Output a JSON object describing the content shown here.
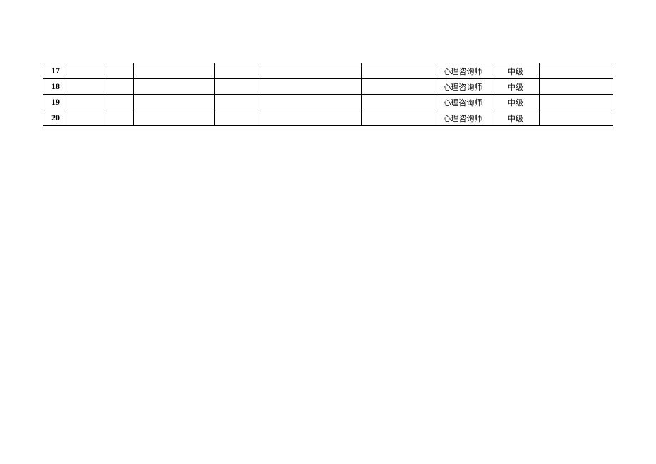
{
  "rows": [
    {
      "num": "17",
      "c2": "",
      "c3": "",
      "c4": "",
      "c5": "",
      "c6": "",
      "c7": "",
      "c8": "心理咨询师",
      "c9": "中级",
      "c10": ""
    },
    {
      "num": "18",
      "c2": "",
      "c3": "",
      "c4": "",
      "c5": "",
      "c6": "",
      "c7": "",
      "c8": "心理咨询师",
      "c9": "中级",
      "c10": ""
    },
    {
      "num": "19",
      "c2": "",
      "c3": "",
      "c4": "",
      "c5": "",
      "c6": "",
      "c7": "",
      "c8": "心理咨询师",
      "c9": "中级",
      "c10": ""
    },
    {
      "num": "20",
      "c2": "",
      "c3": "",
      "c4": "",
      "c5": "",
      "c6": "",
      "c7": "",
      "c8": "心理咨询师",
      "c9": "中级",
      "c10": ""
    }
  ]
}
